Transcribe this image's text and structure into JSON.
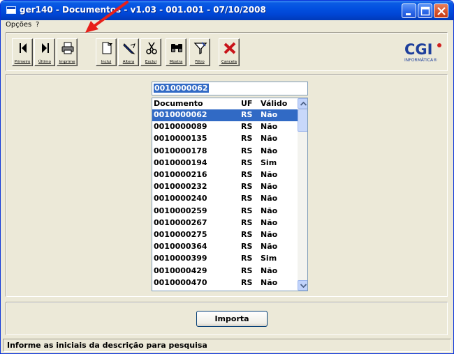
{
  "window": {
    "title": "ger140 - Documentos -  v1.03 - 001.001 - 07/10/2008"
  },
  "menu": {
    "items": [
      {
        "label": "Opções"
      },
      {
        "label": "?"
      }
    ]
  },
  "toolbar": {
    "buttons": [
      {
        "label": "Primeiro",
        "icon": "first-icon"
      },
      {
        "label": "Último",
        "icon": "last-icon"
      },
      {
        "label": "Imprime",
        "icon": "printer-icon"
      },
      {
        "label": "Inclui",
        "icon": "new-document-icon"
      },
      {
        "label": "Altera",
        "icon": "edit-pen-icon"
      },
      {
        "label": "Exclui",
        "icon": "scissors-icon"
      },
      {
        "label": "Mostra",
        "icon": "binoculars-icon"
      },
      {
        "label": "Filtro",
        "icon": "filter-funnel-icon"
      },
      {
        "label": "Cancela",
        "icon": "cancel-x-icon"
      }
    ],
    "logo": {
      "text": "CGI",
      "subtext": "INFORMÁTICA®"
    }
  },
  "search": {
    "value": "0010000062"
  },
  "list": {
    "headers": [
      "Documento",
      "UF",
      "Válido"
    ],
    "selected_index": 0,
    "rows": [
      [
        "0010000062",
        "RS",
        "Não"
      ],
      [
        "0010000089",
        "RS",
        "Não"
      ],
      [
        "0010000135",
        "RS",
        "Não"
      ],
      [
        "0010000178",
        "RS",
        "Não"
      ],
      [
        "0010000194",
        "RS",
        "Sim"
      ],
      [
        "0010000216",
        "RS",
        "Não"
      ],
      [
        "0010000232",
        "RS",
        "Não"
      ],
      [
        "0010000240",
        "RS",
        "Não"
      ],
      [
        "0010000259",
        "RS",
        "Não"
      ],
      [
        "0010000267",
        "RS",
        "Não"
      ],
      [
        "0010000275",
        "RS",
        "Não"
      ],
      [
        "0010000364",
        "RS",
        "Não"
      ],
      [
        "0010000399",
        "RS",
        "Sim"
      ],
      [
        "0010000429",
        "RS",
        "Não"
      ],
      [
        "0010000470",
        "RS",
        "Não"
      ]
    ]
  },
  "actions": {
    "import_label": "Importa"
  },
  "status": {
    "text": "Informe as iniciais da descrição para pesquisa"
  },
  "colors": {
    "selection": "#316ac5",
    "titlebar": "#0250e0",
    "annotation_arrow": "#e8201a"
  }
}
